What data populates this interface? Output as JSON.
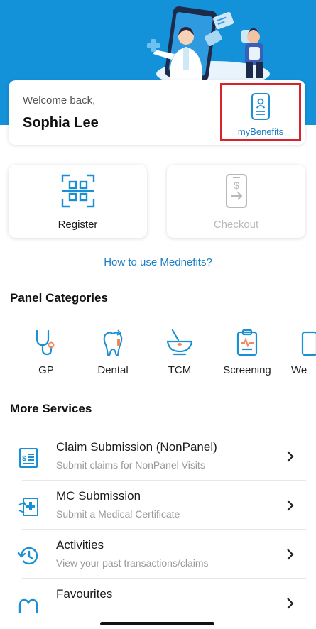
{
  "welcome": {
    "greeting": "Welcome back,",
    "user_name": "Sophia Lee",
    "benefits_label": "myBenefits"
  },
  "actions": {
    "register_label": "Register",
    "checkout_label": "Checkout"
  },
  "how_to_link": "How to use Mednefits?",
  "panel_categories": {
    "title": "Panel Categories",
    "items": [
      {
        "label": "GP",
        "icon": "stethoscope-icon"
      },
      {
        "label": "Dental",
        "icon": "tooth-icon"
      },
      {
        "label": "TCM",
        "icon": "mortar-bowl-icon"
      },
      {
        "label": "Screening",
        "icon": "clipboard-pulse-icon"
      },
      {
        "label": "We",
        "icon": "partial-icon"
      }
    ]
  },
  "more_services": {
    "title": "More Services",
    "items": [
      {
        "title": "Claim Submission (NonPanel)",
        "subtitle": "Submit claims for NonPanel Visits",
        "icon": "receipt-icon"
      },
      {
        "title": "MC Submission",
        "subtitle": "Submit a Medical Certificate",
        "icon": "medical-certificate-icon"
      },
      {
        "title": "Activities",
        "subtitle": "View your past transactions/claims",
        "icon": "history-icon"
      },
      {
        "title": "Favourites",
        "subtitle": "",
        "icon": "heart-icon"
      }
    ]
  },
  "colors": {
    "hero_blue": "#1391d9",
    "accent_blue": "#1a7ec6",
    "highlight_red": "#d8232a",
    "icon_blue": "#1a8fd4",
    "icon_orange": "#f08a5d"
  }
}
